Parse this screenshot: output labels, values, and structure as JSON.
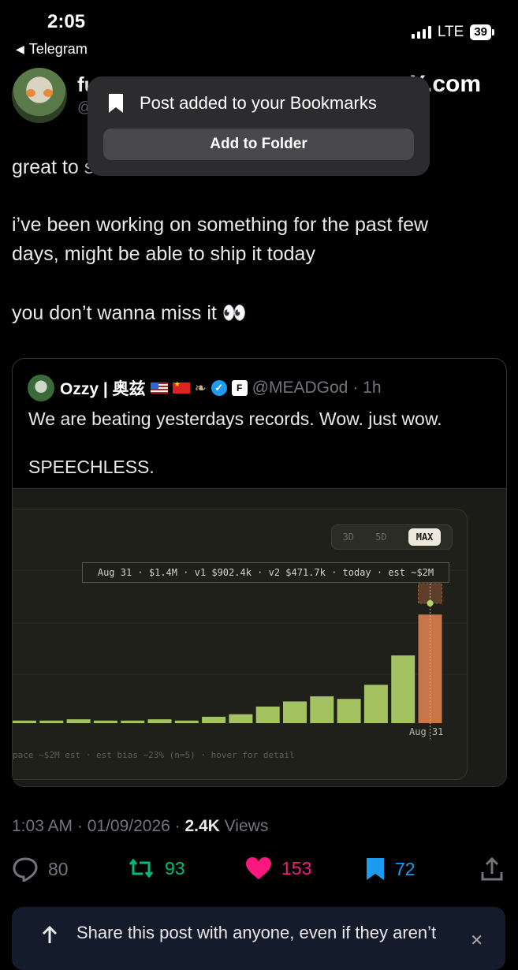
{
  "status": {
    "time": "2:05",
    "back_app": "Telegram",
    "network": "LTE",
    "battery": "39"
  },
  "tweet": {
    "author_name": "fu",
    "handle": "@",
    "name_overflow": "X.com",
    "text_line1": "great to s",
    "text_para2_line1": "i’ve been working on something for the past few",
    "text_para2_line2": "days, might be able to ship it today",
    "text_para3": "you don’t wanna miss it 👀"
  },
  "toast": {
    "message": "Post added to your Bookmarks",
    "button": "Add to Folder"
  },
  "quote": {
    "name": "Ozzy | 奥兹",
    "handle": "@MEADGod",
    "time": "· 1h",
    "text": "We are beating yesterdays records. Wow. just wow.",
    "text2": "SPEECHLESS."
  },
  "chart_data": {
    "type": "bar",
    "range_tabs": [
      "3D",
      "5D",
      "MAX"
    ],
    "active_tab": "MAX",
    "tooltip": "Aug 31 · $1.4M · v1 $902.4k · v2 $471.7k · today · est ~$2M",
    "x_label": "Aug 31",
    "footer": "pace ~$2M est · est bias −23% (n=5) · hover for detail",
    "values_millions": [
      0.02,
      0.02,
      0.03,
      0.02,
      0.02,
      0.03,
      0.02,
      0.05,
      0.07,
      0.13,
      0.17,
      0.21,
      0.19,
      0.3,
      0.53,
      0.85
    ],
    "colors": {
      "bar": "#a5c263",
      "highlight": "#c8754a",
      "marker": "#b5d66a"
    }
  },
  "meta": {
    "time": "1:03 AM · 01/09/2026 · ",
    "views_count": "2.4K",
    "views_label": " Views"
  },
  "actions": {
    "replies": "80",
    "reposts": "93",
    "likes": "153",
    "bookmarks": "72"
  },
  "share_banner": {
    "text": "Share this post with anyone, even if they aren’t"
  }
}
